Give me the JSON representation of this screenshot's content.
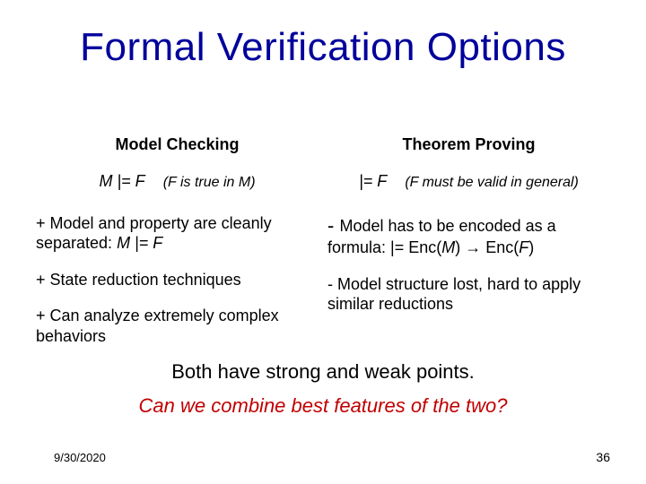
{
  "title": "Formal Verification Options",
  "left": {
    "heading": "Model Checking",
    "notation_stem": "M |= F",
    "notation_paren": "(F is true in M)",
    "pt1_prefix": "+ Model and property are cleanly separated:   ",
    "pt1_ital": "M |= F",
    "pt2": "+ State reduction techniques",
    "pt3": "+ Can analyze extremely complex behaviors"
  },
  "right": {
    "heading": "Theorem Proving",
    "notation_stem": "|= F",
    "notation_paren": "(F must be valid in general)",
    "pt1_lead": "- ",
    "pt1_body": "Model has to be encoded as a formula:      |= Enc(",
    "pt1_m": "M",
    "pt1_mid": ") ",
    "pt1_arrow": "→",
    "pt1_tail": " Enc(",
    "pt1_f": "F",
    "pt1_end": ")",
    "pt2": "- Model structure lost, hard to apply similar reductions"
  },
  "conclusion": "Both have strong and weak points.",
  "question": "Can we combine best features of the two?",
  "footer": {
    "date": "9/30/2020",
    "page": "36"
  }
}
